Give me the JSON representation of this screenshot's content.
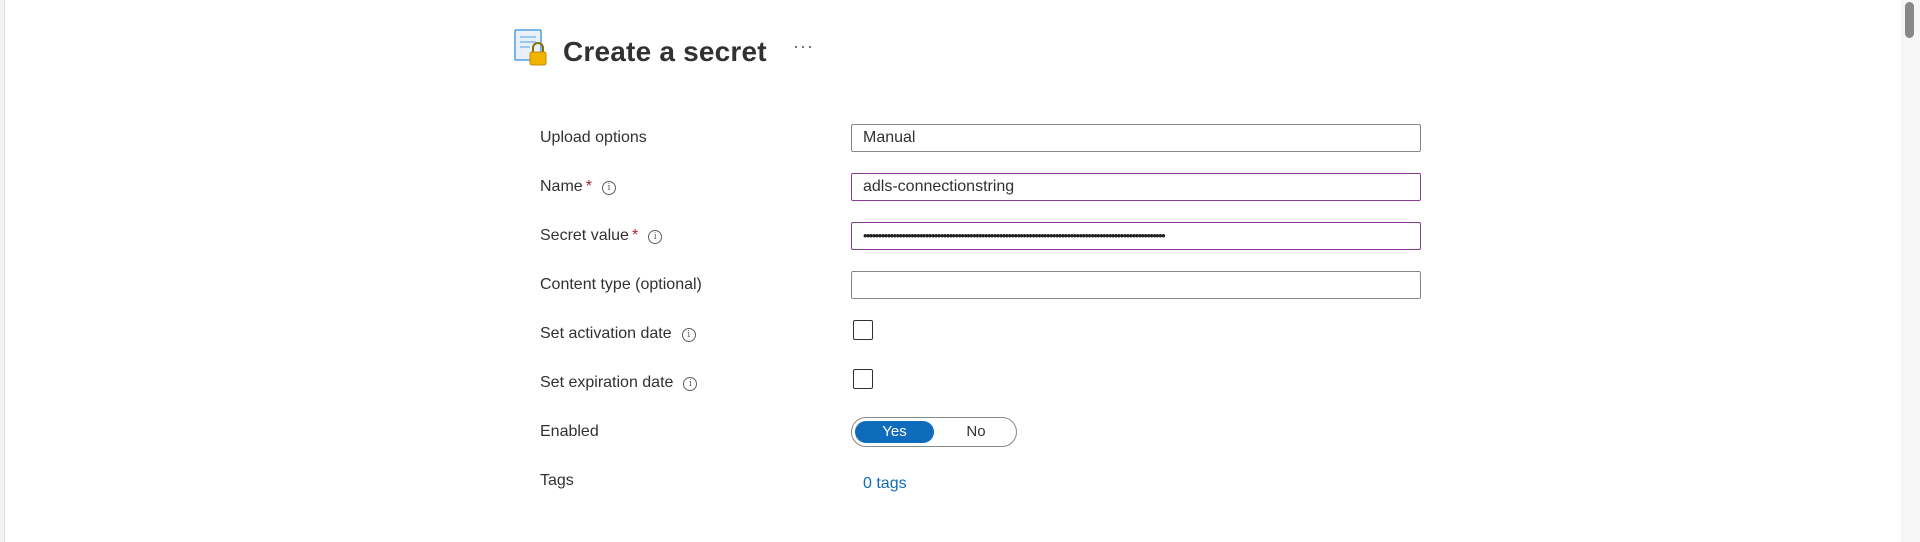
{
  "header": {
    "title": "Create a secret",
    "more_label": "···",
    "icon": "key-vault-secret-icon"
  },
  "form": {
    "upload_options": {
      "label": "Upload options",
      "value": "Manual"
    },
    "name": {
      "label": "Name",
      "required_mark": "*",
      "value": "adls-connectionstring"
    },
    "secret_value": {
      "label": "Secret value",
      "required_mark": "*",
      "value": "••••••••••••••••••••••••••••••••••••••••••••••••••••••••••••••••••••••••••••••••••••••••••••••••••••••"
    },
    "content_type": {
      "label": "Content type (optional)",
      "value": ""
    },
    "activation_date": {
      "label": "Set activation date",
      "checked": false
    },
    "expiration_date": {
      "label": "Set expiration date",
      "checked": false
    },
    "enabled": {
      "label": "Enabled",
      "yes": "Yes",
      "no": "No",
      "selected": "Yes"
    },
    "tags": {
      "label": "Tags",
      "link": "0 tags"
    }
  },
  "info_glyph": "i",
  "colors": {
    "accent": "#0f6cbd",
    "required": "#a4262c",
    "focus_border": "#8a3a96"
  }
}
